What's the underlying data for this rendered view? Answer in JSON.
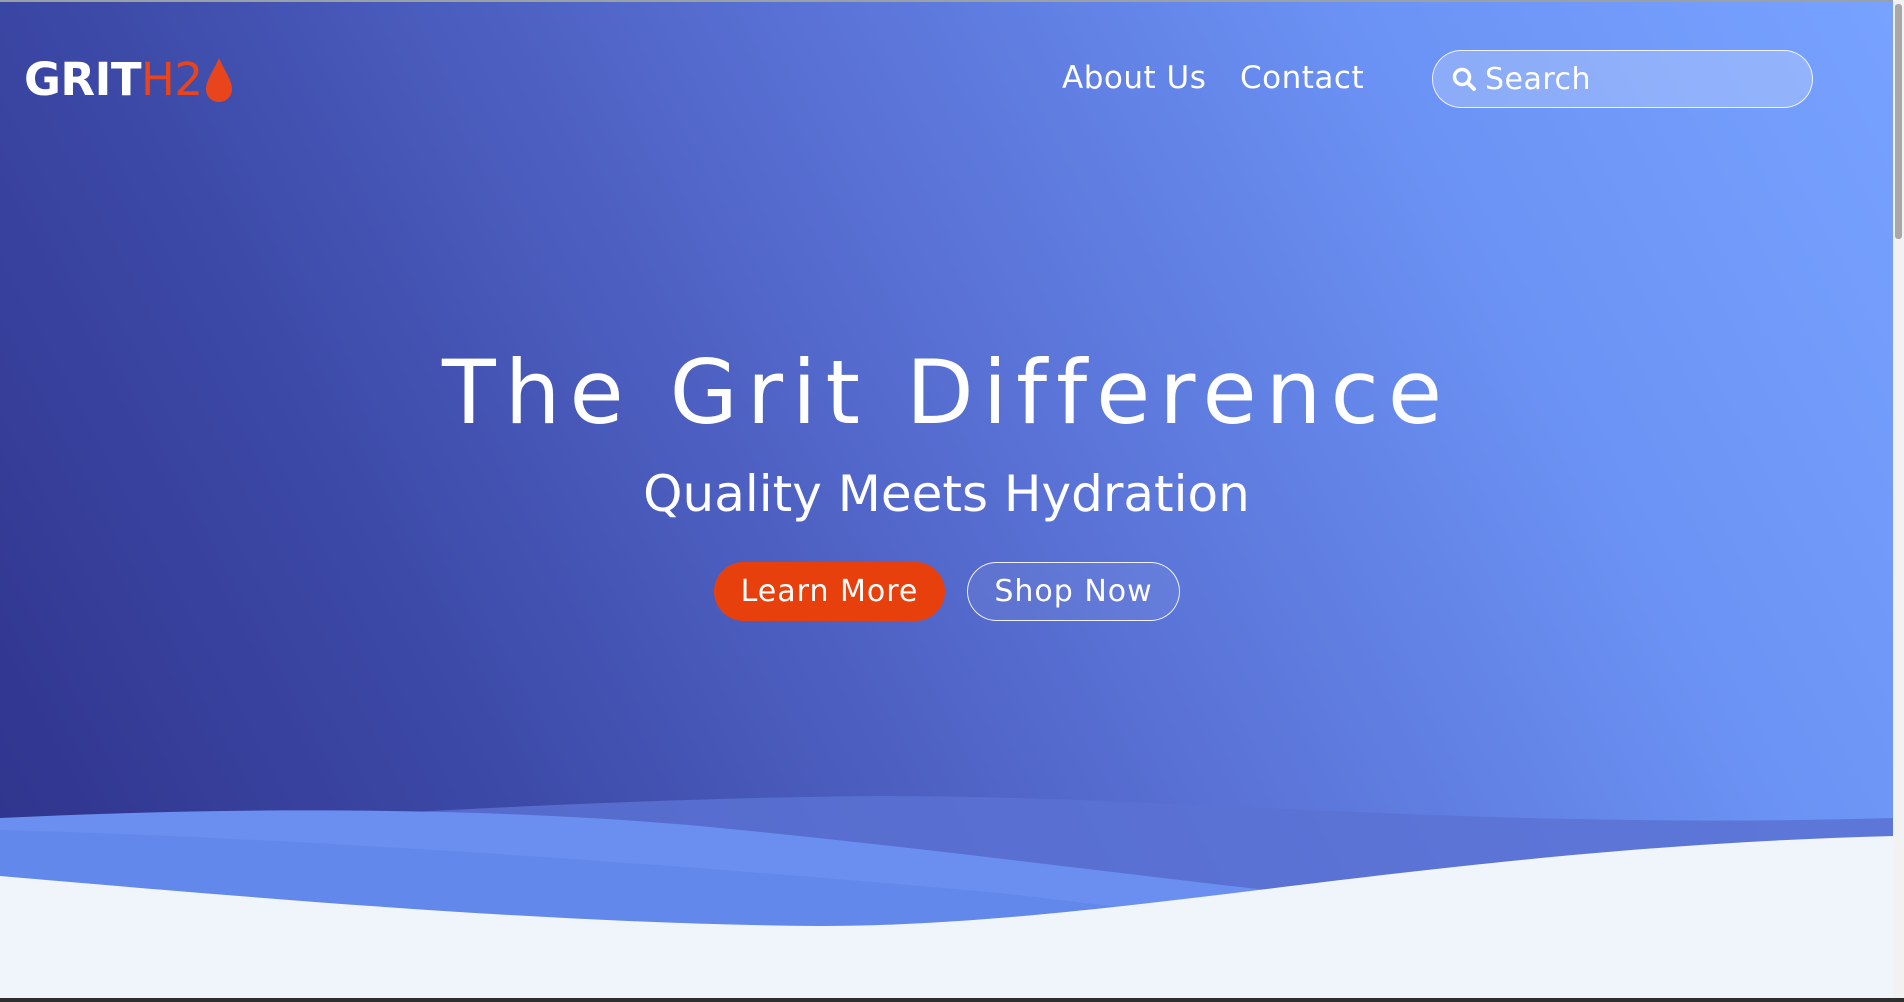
{
  "brand": {
    "logo_primary": "GRIT",
    "logo_accent": "H2",
    "logo_icon": "water-drop-icon",
    "primary_color": "#ffffff",
    "accent_color": "#e8451c"
  },
  "nav": {
    "items": [
      {
        "label": "About Us"
      },
      {
        "label": "Contact"
      }
    ]
  },
  "search": {
    "placeholder": "Search",
    "icon": "search-icon"
  },
  "hero": {
    "headline": "The Grit Difference",
    "subheadline": "Quality Meets Hydration",
    "primary_cta": "Learn More",
    "secondary_cta": "Shop Now",
    "primary_cta_color": "#e8400c",
    "gradient_colors": [
      "#2e3189",
      "#3d4aa8",
      "#5a72d6",
      "#6b93f5",
      "#78a2ff"
    ]
  }
}
